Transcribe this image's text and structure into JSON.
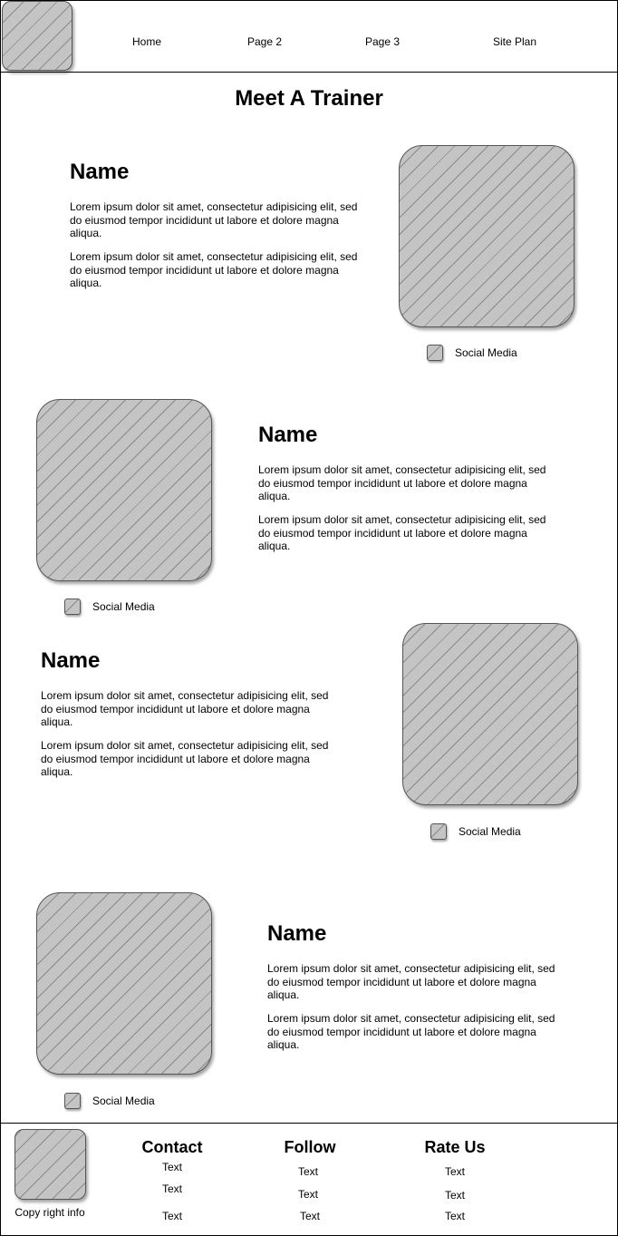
{
  "nav": {
    "home": "Home",
    "page2": "Page 2",
    "page3": "Page 3",
    "site_plan": "Site Plan"
  },
  "page_title": "Meet A Trainer",
  "trainers": [
    {
      "name": "Name",
      "para1": "Lorem ipsum dolor sit amet, consectetur adipisicing elit, sed do eiusmod tempor incididunt ut labore et dolore magna aliqua.",
      "para2": "Lorem ipsum dolor sit amet, consectetur adipisicing elit, sed do eiusmod tempor incididunt ut labore et dolore magna aliqua.",
      "social": "Social Media"
    },
    {
      "name": "Name",
      "para1": "Lorem ipsum dolor sit amet, consectetur adipisicing elit, sed do eiusmod tempor incididunt ut labore et dolore magna aliqua.",
      "para2": "Lorem ipsum dolor sit amet, consectetur adipisicing elit, sed do eiusmod tempor incididunt ut labore et dolore magna aliqua.",
      "social": "Social Media"
    },
    {
      "name": "Name",
      "para1": "Lorem ipsum dolor sit amet, consectetur adipisicing elit, sed do eiusmod tempor incididunt ut labore et dolore magna aliqua.",
      "para2": "Lorem ipsum dolor sit amet, consectetur adipisicing elit, sed do eiusmod tempor incididunt ut labore et dolore magna aliqua.",
      "social": "Social Media"
    },
    {
      "name": "Name",
      "para1": "Lorem ipsum dolor sit amet, consectetur adipisicing elit, sed do eiusmod tempor incididunt ut labore et dolore magna aliqua.",
      "para2": "Lorem ipsum dolor sit amet, consectetur adipisicing elit, sed do eiusmod tempor incididunt ut labore et dolore magna aliqua.",
      "social": "Social Media"
    }
  ],
  "footer": {
    "copyright": "Copy right info",
    "contact": {
      "title": "Contact",
      "items": [
        "Text",
        "Text",
        "Text"
      ]
    },
    "follow": {
      "title": "Follow",
      "items": [
        "Text",
        "Text",
        "Text"
      ]
    },
    "rate": {
      "title": "Rate Us",
      "items": [
        "Text",
        "Text",
        "Text"
      ]
    }
  },
  "colors": {
    "placeholder_fill": "#c4c4c4",
    "placeholder_hatch": "#8a8a8a",
    "border": "#000000"
  }
}
